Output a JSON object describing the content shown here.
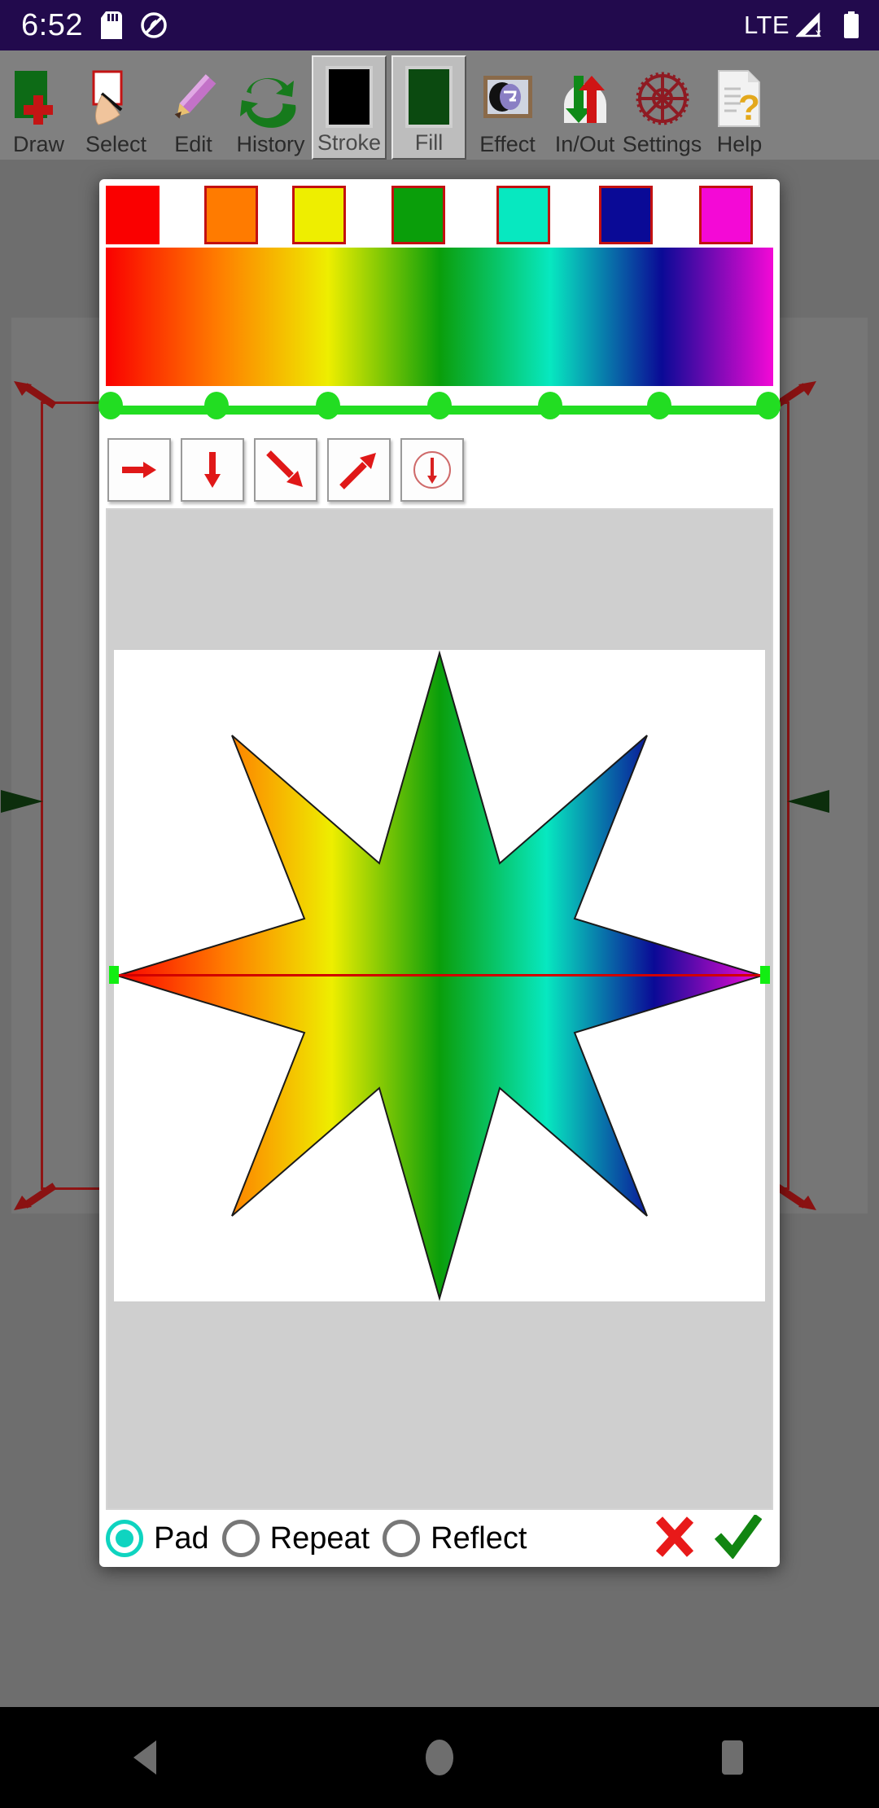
{
  "statusbar": {
    "clock": "6:52",
    "icons": [
      "sd-card-icon",
      "silent-mode-icon"
    ],
    "network": "LTE",
    "right_icons": [
      "signal-no-service-icon",
      "battery-full-icon"
    ]
  },
  "toolbar": {
    "items": [
      {
        "label": "Draw",
        "icon": "new-document-icon",
        "raised": false
      },
      {
        "label": "Select",
        "icon": "hand-select-icon",
        "raised": false
      },
      {
        "label": "Edit",
        "icon": "pencil-icon",
        "raised": false
      },
      {
        "label": "History",
        "icon": "undo-redo-icon",
        "raised": false
      },
      {
        "label": "Stroke",
        "icon": "stroke-swatch-icon",
        "raised": true,
        "swatch": "#000000"
      },
      {
        "label": "Fill",
        "icon": "fill-swatch-icon",
        "raised": true,
        "swatch": "#0b4a10"
      },
      {
        "label": "Effect",
        "icon": "effect-icon",
        "raised": false
      },
      {
        "label": "In/Out",
        "icon": "import-export-icon",
        "raised": false
      },
      {
        "label": "Settings",
        "icon": "gear-icon",
        "raised": false
      },
      {
        "label": "Help",
        "icon": "help-document-icon",
        "raised": false
      }
    ]
  },
  "dialog": {
    "title": "gradient-fill-editor",
    "swatches": [
      {
        "name": "swatch-red",
        "color": "#fa0000",
        "selected": true
      },
      {
        "name": "swatch-orange",
        "color": "#ff7b00",
        "selected": false
      },
      {
        "name": "swatch-yellow",
        "color": "#eeee00",
        "selected": false
      },
      {
        "name": "swatch-green",
        "color": "#0a9e0a",
        "selected": false
      },
      {
        "name": "swatch-cyan",
        "color": "#07e8c0",
        "selected": false
      },
      {
        "name": "swatch-navy",
        "color": "#0a0a96",
        "selected": false
      },
      {
        "name": "swatch-magenta",
        "color": "#f409d6",
        "selected": false
      }
    ],
    "spectrum_stops": [
      "#fa0000",
      "#ff7b00",
      "#eeee00",
      "#0a9e0a",
      "#07e8c0",
      "#0a0a96",
      "#f409d6"
    ],
    "stop_positions_pct": [
      0,
      16.6,
      33.3,
      50,
      66.6,
      83.3,
      100
    ],
    "stop_handle_color": "#22dd22",
    "directions": [
      {
        "name": "direction-horizontal",
        "glyph": "arrow-right-icon",
        "selected": false
      },
      {
        "name": "direction-vertical",
        "glyph": "arrow-down-icon",
        "selected": false
      },
      {
        "name": "direction-diagonal-down",
        "glyph": "arrow-down-right-icon",
        "selected": false
      },
      {
        "name": "direction-diagonal-up",
        "glyph": "arrow-up-right-icon",
        "selected": false
      },
      {
        "name": "direction-radial",
        "glyph": "radial-circle-icon",
        "selected": false
      }
    ],
    "preview": {
      "shape": "eight-point-star",
      "background": "#ffffff",
      "gradient_line_color": "#d10000",
      "handle_color": "#12ee12"
    },
    "spread_modes": [
      {
        "label": "Pad",
        "selected": true
      },
      {
        "label": "Repeat",
        "selected": false
      },
      {
        "label": "Reflect",
        "selected": false
      }
    ],
    "actions": [
      {
        "name": "cancel-button",
        "glyph": "x-icon",
        "color": "#e81919"
      },
      {
        "name": "confirm-button",
        "glyph": "check-icon",
        "color": "#118511"
      }
    ]
  },
  "navbar": {
    "buttons": [
      {
        "name": "nav-back-button",
        "glyph": "triangle-left-icon"
      },
      {
        "name": "nav-home-button",
        "glyph": "circle-icon"
      },
      {
        "name": "nav-recents-button",
        "glyph": "square-icon"
      }
    ]
  },
  "colors": {
    "statusbar_bg": "#220a4d",
    "toolbar_bg": "#808080",
    "app_bg": "#6e6e6e",
    "accent_teal": "#0fd4c0",
    "selection_frame": "#8f1414"
  }
}
